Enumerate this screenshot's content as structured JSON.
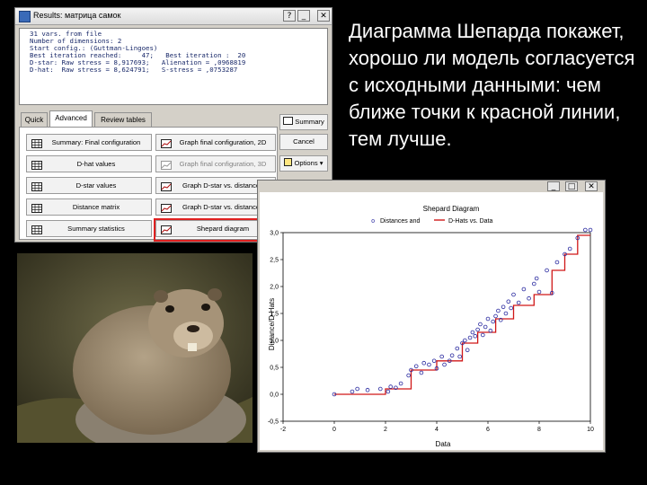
{
  "dialog": {
    "title": "Results: матрица самок",
    "window_buttons": [
      "?",
      "_",
      "□",
      "✕"
    ],
    "report_lines": [
      "31 vars. from file",
      "Number of dimensions: 2",
      "Start config.: (Guttman-Lingoes)",
      "Best iteration reached:     47;   Best iteration :  20",
      "D-star: Raw stress = 8,917693;   Alienation = ,0968819",
      "D-hat:  Raw stress = 8,624791;   S-stress = ,0753287"
    ],
    "tabs": [
      "Quick",
      "Advanced",
      "Review tables"
    ],
    "buttons": [
      "Summary: Final configuration",
      "Graph final configuration, 2D",
      "D-hat values",
      "Graph final configuration, 3D",
      "D-star values",
      "Graph D-star vs. distances",
      "Distance matrix",
      "Graph D-star vs. distances",
      "Summary statistics",
      "Shepard diagram"
    ],
    "side_buttons": [
      "Summary",
      "Cancel",
      "Options ▾"
    ]
  },
  "caption": "Диаграмма Шепарда покажет, хорошо ли модель согласуется с исходными данными: чем ближе точки к красной линии, тем лучше.",
  "shepard_window": {
    "window_buttons": [
      "_",
      "□",
      "✕"
    ],
    "legend": [
      "Distances and",
      "D-Hats vs. Data"
    ]
  },
  "colors": {
    "stepline": "#d01818",
    "points": "#2a2aa0",
    "highlight": "#e02020"
  },
  "chart_data": {
    "type": "scatter",
    "title": "Shepard Diagram",
    "xlabel": "Data",
    "ylabel": "Distance/D-Hats",
    "xlim": [
      -2,
      10
    ],
    "ylim": [
      -0.5,
      3.0
    ],
    "x_ticks": [
      "-2",
      "0",
      "2",
      "4",
      "6",
      "8",
      "10"
    ],
    "y_ticks": [
      "3,0",
      "2,5",
      "2,0",
      "1,5",
      "1,0",
      "0,5",
      "0,0",
      "-0,5"
    ],
    "series": [
      {
        "name": "Distances",
        "marker": "circle",
        "points": [
          [
            0.0,
            0.0
          ],
          [
            0.7,
            0.05
          ],
          [
            0.9,
            0.1
          ],
          [
            1.3,
            0.08
          ],
          [
            1.8,
            0.1
          ],
          [
            2.1,
            0.05
          ],
          [
            2.2,
            0.14
          ],
          [
            2.4,
            0.12
          ],
          [
            2.6,
            0.2
          ],
          [
            2.9,
            0.35
          ],
          [
            3.0,
            0.45
          ],
          [
            3.2,
            0.52
          ],
          [
            3.4,
            0.4
          ],
          [
            3.5,
            0.58
          ],
          [
            3.7,
            0.55
          ],
          [
            3.9,
            0.62
          ],
          [
            4.0,
            0.48
          ],
          [
            4.2,
            0.7
          ],
          [
            4.3,
            0.55
          ],
          [
            4.5,
            0.62
          ],
          [
            4.6,
            0.72
          ],
          [
            4.8,
            0.85
          ],
          [
            4.9,
            0.7
          ],
          [
            5.0,
            0.95
          ],
          [
            5.1,
            1.0
          ],
          [
            5.2,
            0.82
          ],
          [
            5.3,
            1.05
          ],
          [
            5.4,
            1.15
          ],
          [
            5.5,
            1.08
          ],
          [
            5.6,
            1.2
          ],
          [
            5.7,
            1.3
          ],
          [
            5.8,
            1.1
          ],
          [
            5.9,
            1.25
          ],
          [
            6.0,
            1.4
          ],
          [
            6.1,
            1.18
          ],
          [
            6.2,
            1.35
          ],
          [
            6.3,
            1.45
          ],
          [
            6.4,
            1.55
          ],
          [
            6.5,
            1.38
          ],
          [
            6.6,
            1.62
          ],
          [
            6.7,
            1.5
          ],
          [
            6.8,
            1.72
          ],
          [
            6.9,
            1.6
          ],
          [
            7.0,
            1.85
          ],
          [
            7.2,
            1.7
          ],
          [
            7.4,
            1.95
          ],
          [
            7.6,
            1.78
          ],
          [
            7.8,
            2.05
          ],
          [
            7.9,
            2.15
          ],
          [
            8.0,
            1.9
          ],
          [
            8.3,
            2.3
          ],
          [
            8.5,
            1.88
          ],
          [
            8.7,
            2.45
          ],
          [
            9.0,
            2.6
          ],
          [
            9.2,
            2.7
          ],
          [
            9.5,
            2.9
          ],
          [
            9.8,
            3.05
          ],
          [
            10.0,
            3.05
          ]
        ]
      },
      {
        "name": "D-Hats",
        "marker": "step",
        "points": [
          [
            0.0,
            0.0
          ],
          [
            2.0,
            0.0
          ],
          [
            2.0,
            0.1
          ],
          [
            3.0,
            0.1
          ],
          [
            3.0,
            0.45
          ],
          [
            4.0,
            0.45
          ],
          [
            4.0,
            0.62
          ],
          [
            5.0,
            0.62
          ],
          [
            5.0,
            0.95
          ],
          [
            5.6,
            0.95
          ],
          [
            5.6,
            1.15
          ],
          [
            6.3,
            1.15
          ],
          [
            6.3,
            1.4
          ],
          [
            7.0,
            1.4
          ],
          [
            7.0,
            1.65
          ],
          [
            7.8,
            1.65
          ],
          [
            7.8,
            1.85
          ],
          [
            8.5,
            1.85
          ],
          [
            8.5,
            2.3
          ],
          [
            9.0,
            2.3
          ],
          [
            9.0,
            2.6
          ],
          [
            9.5,
            2.6
          ],
          [
            9.5,
            2.95
          ],
          [
            10.0,
            2.95
          ]
        ]
      }
    ]
  }
}
